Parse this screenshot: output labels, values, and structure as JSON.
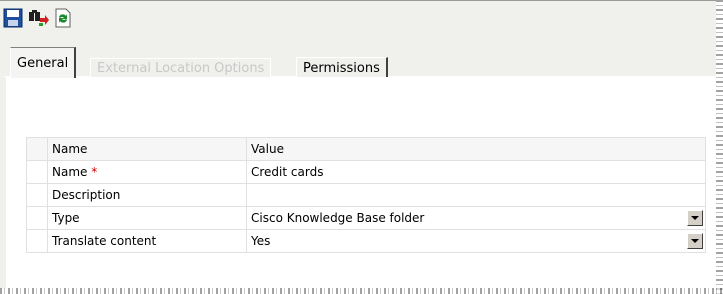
{
  "toolbar": {
    "buttons": [
      {
        "icon": "save-icon"
      },
      {
        "icon": "find-replace-icon"
      },
      {
        "icon": "refresh-icon"
      }
    ]
  },
  "tabs": [
    {
      "label": "General",
      "state": "active"
    },
    {
      "label": "External Location Options",
      "state": "disabled"
    },
    {
      "label": "Permissions",
      "state": "normal"
    }
  ],
  "grid": {
    "headers": [
      "Name",
      "Value"
    ],
    "rows": [
      {
        "name": "Name",
        "required_mark": "*",
        "value": "Credit cards",
        "dropdown": false
      },
      {
        "name": "Description",
        "required_mark": "",
        "value": "",
        "dropdown": false
      },
      {
        "name": "Type",
        "required_mark": "",
        "value": "Cisco Knowledge Base folder",
        "dropdown": true
      },
      {
        "name": "Translate content",
        "required_mark": "",
        "value": "Yes",
        "dropdown": true
      }
    ]
  },
  "colors": {
    "panel": "#f0f0ed",
    "required": "#cc0000",
    "save_blue": "#1f4f9e"
  }
}
